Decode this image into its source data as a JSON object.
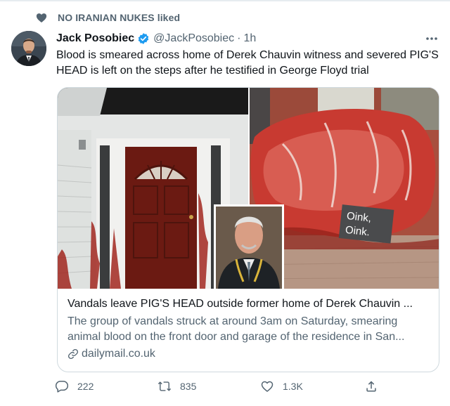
{
  "social_context": {
    "text": "NO IRANIAN NUKES liked",
    "icon": "heart-icon"
  },
  "author": {
    "name": "Jack Posobiec",
    "handle": "@JackPosobiec",
    "separator": "·",
    "time": "1h",
    "verified": true
  },
  "tweet": {
    "text": "Blood is smeared across home of Derek Chauvin witness and severed PIG'S HEAD is left on the steps after he testified in George Floyd trial"
  },
  "card": {
    "sign_text_line1": "Oink,",
    "sign_text_line2": "Oink.",
    "title": "Vandals leave PIG'S HEAD outside former home of Derek Chauvin ...",
    "description": "The group of vandals struck at around 3am on Saturday, smearing animal blood on the front door and garage of the residence in San...",
    "domain": "dailymail.co.uk"
  },
  "actions": {
    "reply": {
      "icon": "reply-icon",
      "count": "222"
    },
    "retweet": {
      "icon": "retweet-icon",
      "count": "835"
    },
    "like": {
      "icon": "heart-icon",
      "count": "1.3K"
    },
    "share": {
      "icon": "share-icon"
    }
  },
  "colors": {
    "text_primary": "#0f1419",
    "text_secondary": "#536471",
    "verified_blue": "#1d9bf0",
    "border": "#cfd9de"
  }
}
